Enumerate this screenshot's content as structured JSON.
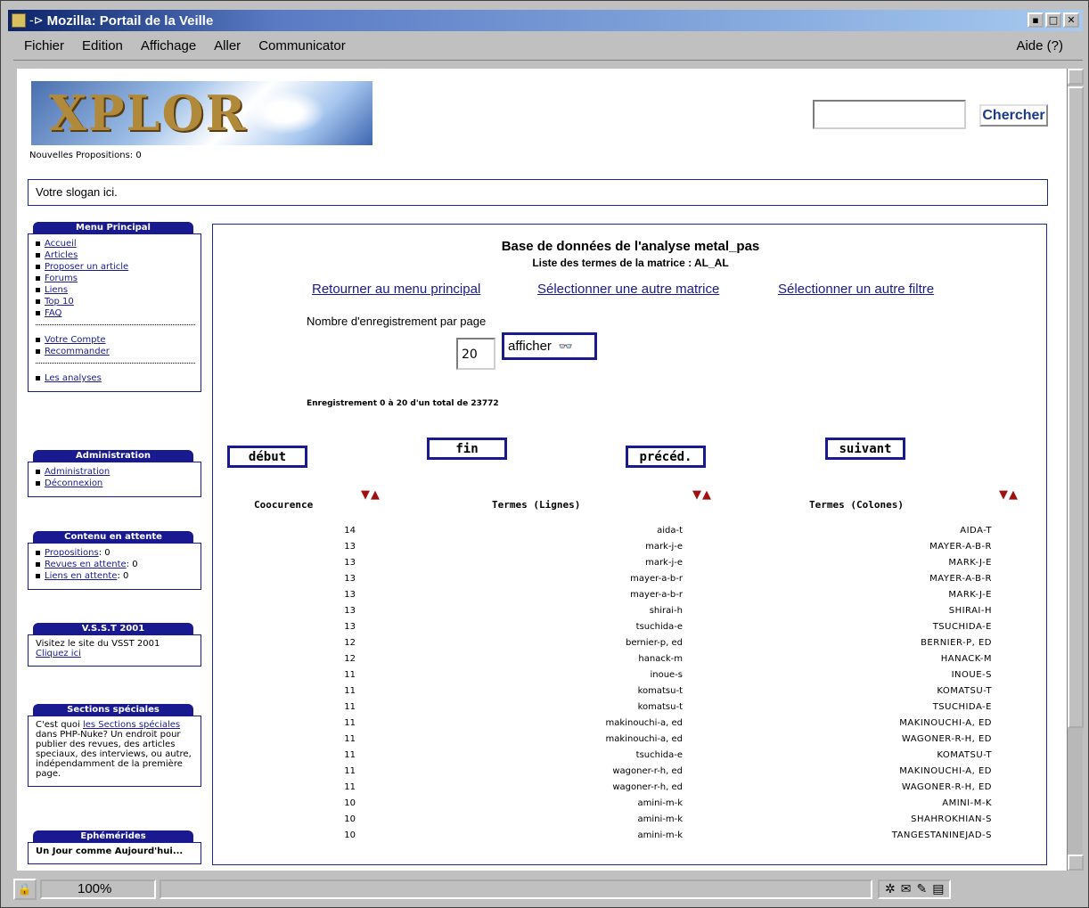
{
  "window": {
    "title": "Mozilla: Portail de la Veille"
  },
  "menubar": {
    "items": [
      "Fichier",
      "Edition",
      "Affichage",
      "Aller",
      "Communicator"
    ],
    "help": "Aide (?)"
  },
  "header": {
    "logo_text": "XPLOR",
    "new_proposals": "Nouvelles Propositions: 0",
    "search_value": "",
    "search_button": "Chercher",
    "slogan": "Votre slogan ici."
  },
  "sidebar": {
    "menu_principal": {
      "title": "Menu Principal",
      "items": [
        "Accueil",
        "Articles",
        "Proposer un article",
        "Forums",
        "Liens",
        "Top 10",
        "FAQ"
      ],
      "items2": [
        "Votre Compte",
        "Recommander"
      ],
      "items3": [
        "Les analyses"
      ]
    },
    "administration": {
      "title": "Administration",
      "items": [
        "Administration",
        "Déconnexion"
      ]
    },
    "contenu": {
      "title": "Contenu en attente",
      "items": [
        {
          "label": "Propositions",
          "count": ": 0"
        },
        {
          "label": "Revues en attente",
          "count": ": 0"
        },
        {
          "label": "Liens en attente",
          "count": ": 0"
        }
      ]
    },
    "vsst": {
      "title": "V.S.S.T 2001",
      "text": "Visitez le site du VSST 2001",
      "link": "Cliquez ici"
    },
    "sections": {
      "title": "Sections spéciales",
      "text_pre": "C'est quoi ",
      "link": "les Sections spéciales",
      "text_post": " dans PHP-Nuke? Un endroit pour publier des revues, des articles speciaux, des interviews, ou autre, indépendamment de la première page."
    },
    "ephemerides": {
      "title": "Ephémérides",
      "text": "Un Jour comme Aujourd'hui..."
    }
  },
  "main": {
    "title": "Base de données de l'analyse metal_pas",
    "subtitle": "Liste des termes de la matrice : AL_AL",
    "links": [
      "Retourner au menu principal",
      "Sélectionner une autre matrice",
      "Sélectionner un autre filtre"
    ],
    "per_page_label": "Nombre d'enregistrement par page",
    "per_page_value": "20",
    "afficher": "afficher",
    "record_info": "Enregistrement 0 à 20 d'un total de 23772",
    "nav": {
      "debut": "début",
      "fin": "fin",
      "preced": "précéd.",
      "suivant": "suivant"
    },
    "columns": [
      "Coocurence",
      "Termes (Lignes)",
      "Termes (Colones)"
    ],
    "rows": [
      [
        "14",
        "aida-t",
        "AIDA-T"
      ],
      [
        "13",
        "mark-j-e",
        "MAYER-A-B-R"
      ],
      [
        "13",
        "mark-j-e",
        "MARK-J-E"
      ],
      [
        "13",
        "mayer-a-b-r",
        "MAYER-A-B-R"
      ],
      [
        "13",
        "mayer-a-b-r",
        "MARK-J-E"
      ],
      [
        "13",
        "shirai-h",
        "SHIRAI-H"
      ],
      [
        "13",
        "tsuchida-e",
        "TSUCHIDA-E"
      ],
      [
        "12",
        "bernier-p, ed",
        "BERNIER-P, ED"
      ],
      [
        "12",
        "hanack-m",
        "HANACK-M"
      ],
      [
        "11",
        "inoue-s",
        "INOUE-S"
      ],
      [
        "11",
        "komatsu-t",
        "KOMATSU-T"
      ],
      [
        "11",
        "komatsu-t",
        "TSUCHIDA-E"
      ],
      [
        "11",
        "makinouchi-a, ed",
        "MAKINOUCHI-A, ED"
      ],
      [
        "11",
        "makinouchi-a, ed",
        "WAGONER-R-H, ED"
      ],
      [
        "11",
        "tsuchida-e",
        "KOMATSU-T"
      ],
      [
        "11",
        "wagoner-r-h, ed",
        "MAKINOUCHI-A, ED"
      ],
      [
        "11",
        "wagoner-r-h, ed",
        "WAGONER-R-H, ED"
      ],
      [
        "10",
        "amini-m-k",
        "AMINI-M-K"
      ],
      [
        "10",
        "amini-m-k",
        "SHAHROKHIAN-S"
      ],
      [
        "10",
        "amini-m-k",
        "TANGESTANINEJAD-S"
      ]
    ]
  },
  "statusbar": {
    "zoom": "100%"
  }
}
